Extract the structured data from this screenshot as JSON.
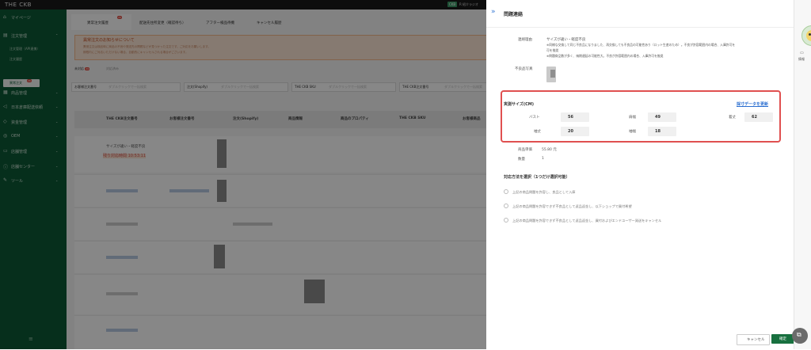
{
  "topbar": {
    "logo": "THE CKB",
    "badge": "CKB",
    "user": "R 紹介ラジオ"
  },
  "sidebar": {
    "items": [
      {
        "icon": "home-icon",
        "label": "マイページ"
      },
      {
        "icon": "orders-icon",
        "label": "注文管理"
      },
      {
        "icon": "product-icon",
        "label": "商品管理"
      },
      {
        "icon": "send-icon",
        "label": "日本倉庫配送依頼"
      },
      {
        "icon": "wallet-icon",
        "label": "資金管理"
      },
      {
        "icon": "oem-icon",
        "label": "OEM"
      },
      {
        "icon": "store-icon",
        "label": "店舗管理"
      },
      {
        "icon": "info-icon",
        "label": "店舗センター"
      },
      {
        "icon": "tool-icon",
        "label": "ツール"
      }
    ],
    "sub_items": [
      "注文管理（API連携）",
      "注文履歴"
    ],
    "active_item": {
      "label": "異常注文",
      "count": "26"
    }
  },
  "main": {
    "tabs": [
      {
        "label": "異常注文履歴",
        "count": "26"
      },
      {
        "label": "配送先住所変更（確認待ち）"
      },
      {
        "label": "アフター検品待機"
      },
      {
        "label": "キャンセル履歴"
      }
    ],
    "notice": {
      "title": "異常注文のお知らせについて",
      "lines": [
        "異常注文は検品時に商品の不良や発送先の問題などが見つかった注文です。ご対応をお願いします。",
        "期限内にご対応いただけない場合、自動的にキャンセルされる場合がございます。"
      ]
    },
    "subtabs": [
      {
        "label": "未対応",
        "count": "26"
      },
      {
        "label": "対応済み"
      }
    ],
    "filters": [
      {
        "label": "お客様注文番号",
        "placeholder": "ダブルクリックで一括検索"
      },
      {
        "label": "注文(Shopify)",
        "placeholder": "ダブルクリックで一括検索"
      },
      {
        "label": "THE CKB SKU",
        "placeholder": "ダブルクリックで一括検索"
      },
      {
        "label": "THE CKB注文番号",
        "placeholder": "ダブルクリックで一括検索"
      }
    ],
    "columns": [
      "THE CKB注文番号",
      "お客様注文番号",
      "注文(Shopify)",
      "商品情報",
      "商品のプロパティ",
      "THE CKB SKU",
      "お客様商品"
    ],
    "row1": {
      "reason": "サイズが違い・軽度不良",
      "deadline": "残り対応時間 10:53:11"
    }
  },
  "drawer": {
    "title": "問題連絡",
    "reason_label": "連絡理由",
    "reason_lines": [
      "サイズが違い・軽度不良",
      "※同様な交換して同じ不良品になりました、再交換しても不良品の可能性あり（ロット生産のため）。不良が許容範囲内の場合、入庫許可を",
      "可を推奨",
      "※問題商品数が多く、納期遅延の可能性大。不良が許容範囲内の場合、入庫許可を推奨"
    ],
    "photo_label": "不良品写真",
    "size": {
      "title": "実測サイズ(CM)",
      "update_link": "採寸データを更新",
      "fields": [
        {
          "label": "バスト",
          "value": "56"
        },
        {
          "label": "肩幅",
          "value": "49"
        },
        {
          "label": "着丈",
          "value": "62"
        },
        {
          "label": "袖丈",
          "value": "20"
        },
        {
          "label": "袖幅",
          "value": "18"
        }
      ]
    },
    "unit_price_label": "商品単価",
    "unit_price": "55.80 元",
    "qty_label": "数量",
    "qty": "1",
    "options_title": "対応方法を選択（1つだけ選択可能）",
    "options": [
      "上記の商品問題を許容し、良品として入庫",
      "上記の商品問題を許容できず不良品として返品返金し、以下ショップで買付希望",
      "上記の商品問題を許容できず不良品として返品返金し、買付およびエンドユーザー発送をキャンセル"
    ],
    "cancel": "キャンセル",
    "confirm": "確定",
    "side_label": "情報"
  }
}
